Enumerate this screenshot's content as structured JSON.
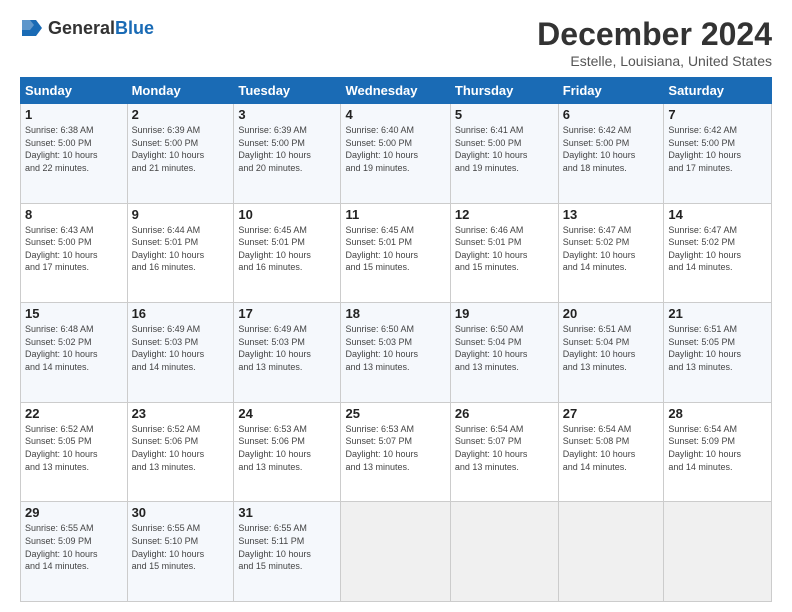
{
  "header": {
    "logo_general": "General",
    "logo_blue": "Blue",
    "title": "December 2024",
    "subtitle": "Estelle, Louisiana, United States"
  },
  "weekdays": [
    "Sunday",
    "Monday",
    "Tuesday",
    "Wednesday",
    "Thursday",
    "Friday",
    "Saturday"
  ],
  "weeks": [
    [
      {
        "day": "1",
        "info": "Sunrise: 6:38 AM\nSunset: 5:00 PM\nDaylight: 10 hours\nand 22 minutes."
      },
      {
        "day": "2",
        "info": "Sunrise: 6:39 AM\nSunset: 5:00 PM\nDaylight: 10 hours\nand 21 minutes."
      },
      {
        "day": "3",
        "info": "Sunrise: 6:39 AM\nSunset: 5:00 PM\nDaylight: 10 hours\nand 20 minutes."
      },
      {
        "day": "4",
        "info": "Sunrise: 6:40 AM\nSunset: 5:00 PM\nDaylight: 10 hours\nand 19 minutes."
      },
      {
        "day": "5",
        "info": "Sunrise: 6:41 AM\nSunset: 5:00 PM\nDaylight: 10 hours\nand 19 minutes."
      },
      {
        "day": "6",
        "info": "Sunrise: 6:42 AM\nSunset: 5:00 PM\nDaylight: 10 hours\nand 18 minutes."
      },
      {
        "day": "7",
        "info": "Sunrise: 6:42 AM\nSunset: 5:00 PM\nDaylight: 10 hours\nand 17 minutes."
      }
    ],
    [
      {
        "day": "8",
        "info": "Sunrise: 6:43 AM\nSunset: 5:00 PM\nDaylight: 10 hours\nand 17 minutes."
      },
      {
        "day": "9",
        "info": "Sunrise: 6:44 AM\nSunset: 5:01 PM\nDaylight: 10 hours\nand 16 minutes."
      },
      {
        "day": "10",
        "info": "Sunrise: 6:45 AM\nSunset: 5:01 PM\nDaylight: 10 hours\nand 16 minutes."
      },
      {
        "day": "11",
        "info": "Sunrise: 6:45 AM\nSunset: 5:01 PM\nDaylight: 10 hours\nand 15 minutes."
      },
      {
        "day": "12",
        "info": "Sunrise: 6:46 AM\nSunset: 5:01 PM\nDaylight: 10 hours\nand 15 minutes."
      },
      {
        "day": "13",
        "info": "Sunrise: 6:47 AM\nSunset: 5:02 PM\nDaylight: 10 hours\nand 14 minutes."
      },
      {
        "day": "14",
        "info": "Sunrise: 6:47 AM\nSunset: 5:02 PM\nDaylight: 10 hours\nand 14 minutes."
      }
    ],
    [
      {
        "day": "15",
        "info": "Sunrise: 6:48 AM\nSunset: 5:02 PM\nDaylight: 10 hours\nand 14 minutes."
      },
      {
        "day": "16",
        "info": "Sunrise: 6:49 AM\nSunset: 5:03 PM\nDaylight: 10 hours\nand 14 minutes."
      },
      {
        "day": "17",
        "info": "Sunrise: 6:49 AM\nSunset: 5:03 PM\nDaylight: 10 hours\nand 13 minutes."
      },
      {
        "day": "18",
        "info": "Sunrise: 6:50 AM\nSunset: 5:03 PM\nDaylight: 10 hours\nand 13 minutes."
      },
      {
        "day": "19",
        "info": "Sunrise: 6:50 AM\nSunset: 5:04 PM\nDaylight: 10 hours\nand 13 minutes."
      },
      {
        "day": "20",
        "info": "Sunrise: 6:51 AM\nSunset: 5:04 PM\nDaylight: 10 hours\nand 13 minutes."
      },
      {
        "day": "21",
        "info": "Sunrise: 6:51 AM\nSunset: 5:05 PM\nDaylight: 10 hours\nand 13 minutes."
      }
    ],
    [
      {
        "day": "22",
        "info": "Sunrise: 6:52 AM\nSunset: 5:05 PM\nDaylight: 10 hours\nand 13 minutes."
      },
      {
        "day": "23",
        "info": "Sunrise: 6:52 AM\nSunset: 5:06 PM\nDaylight: 10 hours\nand 13 minutes."
      },
      {
        "day": "24",
        "info": "Sunrise: 6:53 AM\nSunset: 5:06 PM\nDaylight: 10 hours\nand 13 minutes."
      },
      {
        "day": "25",
        "info": "Sunrise: 6:53 AM\nSunset: 5:07 PM\nDaylight: 10 hours\nand 13 minutes."
      },
      {
        "day": "26",
        "info": "Sunrise: 6:54 AM\nSunset: 5:07 PM\nDaylight: 10 hours\nand 13 minutes."
      },
      {
        "day": "27",
        "info": "Sunrise: 6:54 AM\nSunset: 5:08 PM\nDaylight: 10 hours\nand 14 minutes."
      },
      {
        "day": "28",
        "info": "Sunrise: 6:54 AM\nSunset: 5:09 PM\nDaylight: 10 hours\nand 14 minutes."
      }
    ],
    [
      {
        "day": "29",
        "info": "Sunrise: 6:55 AM\nSunset: 5:09 PM\nDaylight: 10 hours\nand 14 minutes."
      },
      {
        "day": "30",
        "info": "Sunrise: 6:55 AM\nSunset: 5:10 PM\nDaylight: 10 hours\nand 15 minutes."
      },
      {
        "day": "31",
        "info": "Sunrise: 6:55 AM\nSunset: 5:11 PM\nDaylight: 10 hours\nand 15 minutes."
      },
      {
        "day": "",
        "info": ""
      },
      {
        "day": "",
        "info": ""
      },
      {
        "day": "",
        "info": ""
      },
      {
        "day": "",
        "info": ""
      }
    ]
  ]
}
